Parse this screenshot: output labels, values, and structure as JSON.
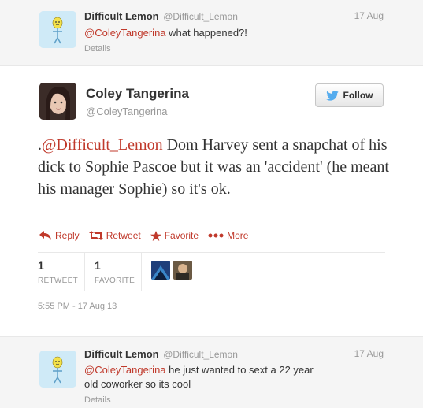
{
  "top_reply": {
    "name": "Difficult Lemon",
    "handle": "@Difficult_Lemon",
    "date": "17 Aug",
    "mention": "@ColeyTangerina",
    "text": " what happened?!",
    "details_label": "Details"
  },
  "main_tweet": {
    "name": "Coley Tangerina",
    "handle": "@ColeyTangerina",
    "follow_label": "Follow",
    "text_prefix": ".",
    "mention": "@Difficult_Lemon",
    "text": " Dom Harvey sent a snapchat of his dick to Sophie Pascoe but it was an 'accident' (he meant his manager Sophie) so it's ok.",
    "actions": {
      "reply": "Reply",
      "retweet": "Retweet",
      "favorite": "Favorite",
      "more": "More"
    },
    "stats": {
      "retweets_count": "1",
      "retweets_label": "RETWEET",
      "favorites_count": "1",
      "favorites_label": "FAVORITE"
    },
    "timestamp": "5:55 PM - 17 Aug 13"
  },
  "bottom_reply": {
    "name": "Difficult Lemon",
    "handle": "@Difficult_Lemon",
    "date": "17 Aug",
    "mention": "@ColeyTangerina",
    "text": " he just wanted to sext a 22 year old coworker so its cool",
    "details_label": "Details"
  },
  "colors": {
    "accent": "#c0392b",
    "twitter_blue": "#55acee",
    "muted": "#999999"
  }
}
